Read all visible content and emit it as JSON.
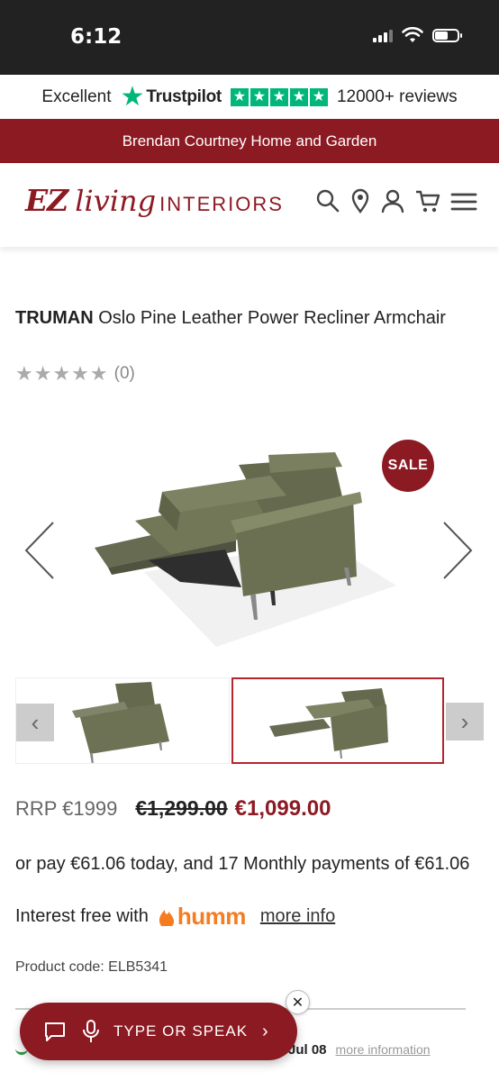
{
  "status": {
    "time": "6:12"
  },
  "trustbar": {
    "rating_word": "Excellent",
    "brand": "Trustpilot",
    "reviews": "12000+ reviews"
  },
  "store_banner": "Brendan Courtney Home and Garden",
  "header": {
    "logo_ez": "EZ",
    "logo_living": "living",
    "logo_interiors": "INTERIORS",
    "icons": [
      "search-icon",
      "location-icon",
      "account-icon",
      "cart-icon",
      "menu-icon"
    ]
  },
  "product": {
    "brand": "TRUMAN",
    "name": "Oslo Pine Leather Power Recliner Armchair",
    "rating_count": "(0)",
    "sale_badge": "SALE",
    "rrp": "RRP €1999",
    "old_price": "€1,299.00",
    "price": "€1,099.00",
    "finance_text": "or pay €61.06 today, and 17 Monthly payments of €61.06",
    "interest_text": "Interest free with",
    "humm_brand": "humm",
    "more_info": "more info",
    "product_code": "Product code: ELB5341"
  },
  "delivery": {
    "date": "Jul 08",
    "more": "more information"
  },
  "voice_assistant": {
    "label": "TYPE OR SPEAK",
    "chevron": "›"
  },
  "colors": {
    "brand": "#8c1a23",
    "trustpilot": "#00b67a",
    "humm": "#f57c21"
  }
}
